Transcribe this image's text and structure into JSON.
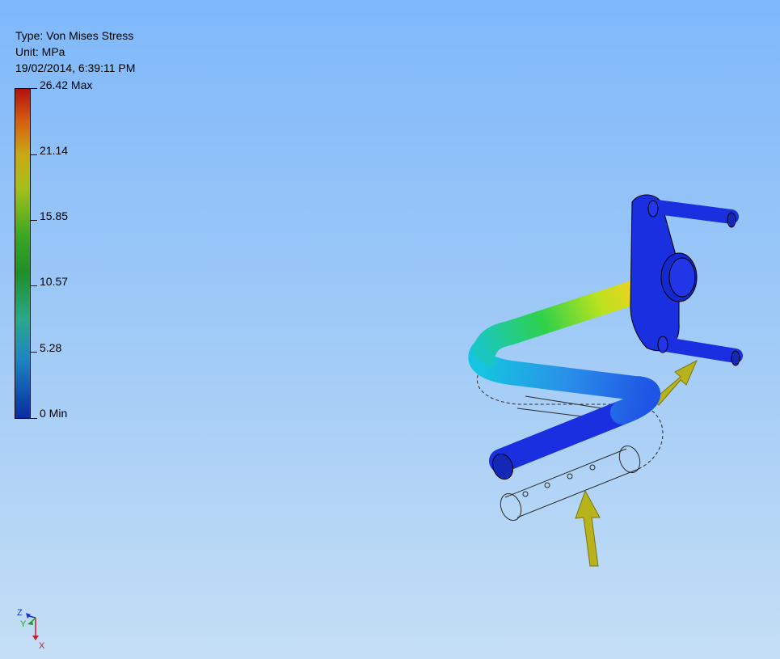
{
  "info": {
    "type_line": "Type: Von Mises Stress",
    "unit_line": "Unit: MPa",
    "date_line": "19/02/2014, 6:39:11 PM"
  },
  "legend": {
    "labels": [
      "26.42 Max",
      "21.14",
      "15.85",
      "10.57",
      "5.28",
      "0 Min"
    ],
    "colors": {
      "max": "#b21010",
      "high": "#d5610f",
      "mid_high": "#c9a815",
      "mid": "#39a623",
      "low": "#1c86c2",
      "min": "#0a2ca0"
    }
  },
  "triad": {
    "z": "Z",
    "y": "Y",
    "x": "X"
  },
  "model": {
    "load_arrow_color": "#b8b31a",
    "part_color": "#1a2fe0"
  }
}
